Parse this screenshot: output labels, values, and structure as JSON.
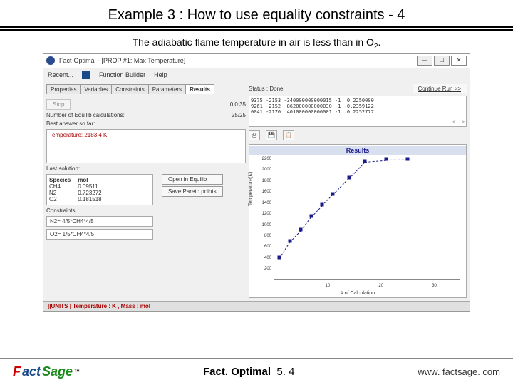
{
  "slide": {
    "title": "Example 3 : How to use equality constraints - 4",
    "caption_a": "The adiabatic flame temperature in air is less than in O",
    "caption_sub": "2",
    "caption_b": "."
  },
  "app": {
    "title": "Fact-Optimal - [PROP #1: Max Temperature]",
    "menu": {
      "recent": "Recent...",
      "fb": "Function Builder",
      "help": "Help"
    },
    "tabs": [
      "Properties",
      "Variables",
      "Constraints",
      "Parameters",
      "Results"
    ],
    "active_tab": "Results",
    "stop": "Stop",
    "elapsed": "0:0:35",
    "num_calc_label": "Number of Equilib calculations:",
    "num_calc_value": "25/25",
    "best_label": "Best answer so far:",
    "best_value": "Temperature: 2183.4 K",
    "last_label": "Last solution:",
    "species_hdr": {
      "name": "Species",
      "mol": "mol"
    },
    "species": [
      {
        "name": "CH4",
        "mol": "0.09511"
      },
      {
        "name": "N2",
        "mol": "0.723272"
      },
      {
        "name": "O2",
        "mol": "0.181518"
      }
    ],
    "open_equilib": "Open in Equilib",
    "save_pareto": "Save Pareto points",
    "constraints_label": "Constraints:",
    "constraints": [
      "N2= 4/5*CH4*4/5",
      "O2= 1/5*CH4*4/5"
    ],
    "status_label": "Status :",
    "status_value": "Done.",
    "continue": "Continue Run >>",
    "data_rows": [
      "9375 -2153 -340000000000015 -1  0 2250000",
      "9261 -2152  862000000000030 -1 -0.2359122",
      "0041 -2170  401000000000001 -1  0 2252777"
    ],
    "statusbar": "||UNITS | Temperature : K , Mass : mol"
  },
  "chart_data": {
    "type": "line",
    "title": "Results",
    "xlabel": "# of Calculation",
    "ylabel": "Temperature(K)",
    "ylim": [
      0,
      2200
    ],
    "xlim": [
      0,
      35
    ],
    "xticks": [
      10,
      20,
      30
    ],
    "yticks": [
      200,
      400,
      600,
      800,
      1000,
      1200,
      1400,
      1600,
      1800,
      2000,
      2200
    ],
    "x": [
      1,
      3,
      5,
      7,
      9,
      11,
      14,
      17,
      21,
      25
    ],
    "y": [
      400,
      700,
      900,
      1150,
      1350,
      1550,
      1850,
      2150,
      2180,
      2183
    ]
  },
  "footer": {
    "product": "Fact. Optimal",
    "version": "5. 4",
    "url": "www. factsage. com"
  }
}
